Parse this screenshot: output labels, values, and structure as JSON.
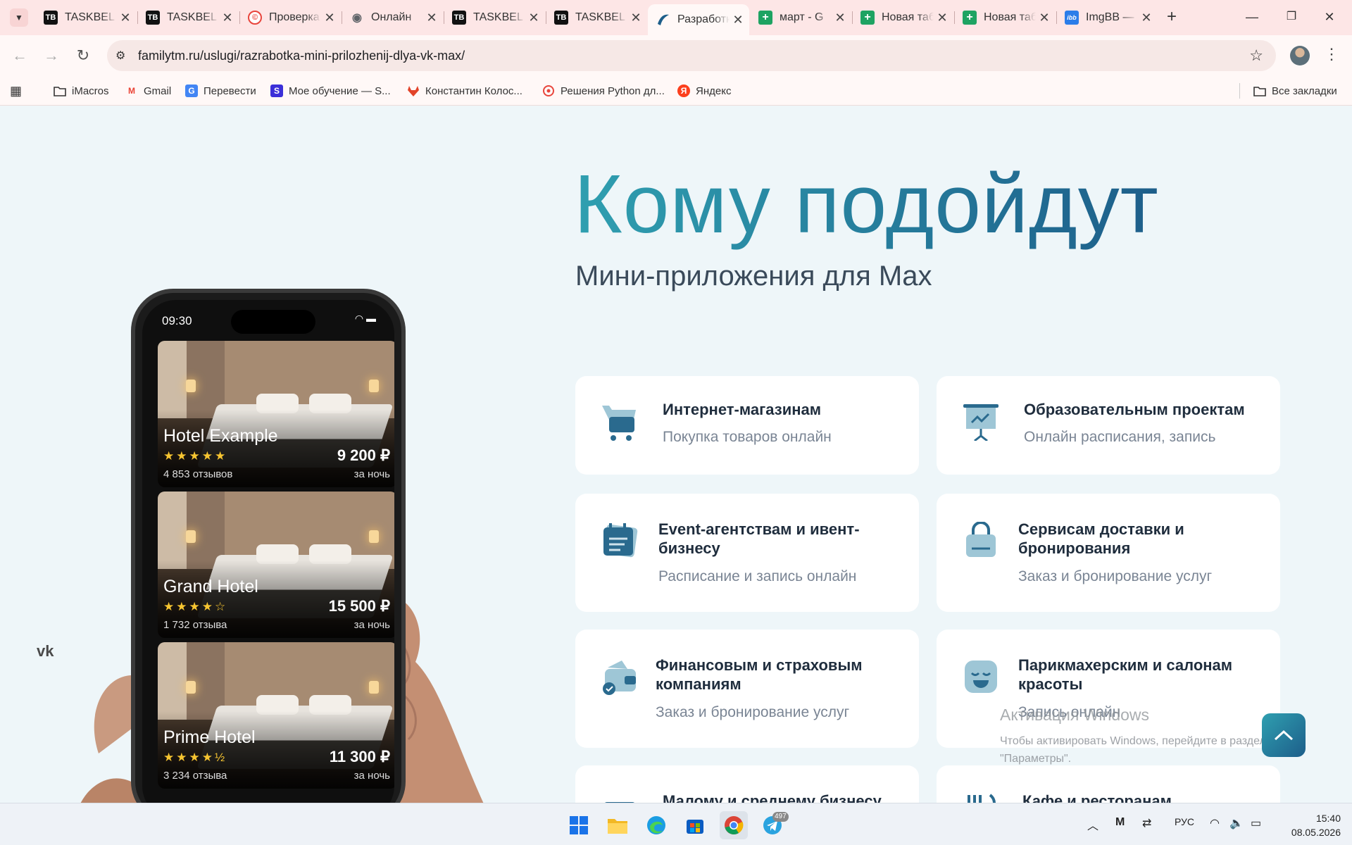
{
  "tabs": [
    {
      "title": "TASKBEL",
      "icon": "taskbel-icon",
      "color": "#111111"
    },
    {
      "title": "TASKBEL",
      "icon": "taskbel-icon",
      "color": "#111111"
    },
    {
      "title": "Проверка",
      "icon": "copyright-icon",
      "color": "#e8453c"
    },
    {
      "title": "Онлайн",
      "icon": "eye-icon",
      "color": "#5f6368"
    },
    {
      "title": "TASKBEL",
      "icon": "taskbel-icon",
      "color": "#111111"
    },
    {
      "title": "TASKBEL",
      "icon": "taskbel-icon",
      "color": "#111111"
    },
    {
      "title": "Разработка",
      "icon": "familytm-icon",
      "color": "#1d5e8a"
    },
    {
      "title": "март - G",
      "icon": "sheets-plus-icon",
      "color": "#1ea362"
    },
    {
      "title": "Новая таблица",
      "icon": "sheets-plus-icon",
      "color": "#1ea362"
    },
    {
      "title": "Новая таблица",
      "icon": "sheets-plus-icon",
      "color": "#1ea362"
    },
    {
      "title": "ImgBB —",
      "icon": "imgbb-icon",
      "color": "#2b7de9"
    }
  ],
  "tab_badges": {
    "tb": "TB",
    "ibb": "ibb",
    "plus": "+"
  },
  "address": {
    "url": "familytm.ru/uslugi/razrabotka-mini-prilozhenij-dlya-vk-max/"
  },
  "bookmarks": [
    {
      "label": "iMacros",
      "icon": "folder-icon"
    },
    {
      "label": "Gmail",
      "icon": "gmail-icon",
      "glyph": "M"
    },
    {
      "label": "Перевести",
      "icon": "translate-icon",
      "glyph": "G"
    },
    {
      "label": "Мое обучение — S...",
      "icon": "skillbox-icon",
      "glyph": "S"
    },
    {
      "label": "Константин Колос...",
      "icon": "gitlab-icon",
      "glyph": ""
    },
    {
      "label": "Решения Python дл...",
      "icon": "python-solutions-icon",
      "glyph": ""
    },
    {
      "label": "Яндекс",
      "icon": "yandex-icon",
      "glyph": "Я"
    }
  ],
  "all_bookmarks": "Все закладки",
  "hero": {
    "title": "Кому подойдут",
    "subtitle": "Мини-приложения для Max"
  },
  "phone": {
    "time": "09:30",
    "hotels": [
      {
        "name": "Hotel Example",
        "stars": "★★★★★",
        "rating": 5,
        "reviews": "4 853 отзывов",
        "price": "9 200 ₽",
        "per": "за ночь"
      },
      {
        "name": "Grand Hotel",
        "stars": "★★★★☆",
        "rating": 4,
        "reviews": "1 732 отзыва",
        "price": "15 500 ₽",
        "per": "за ночь"
      },
      {
        "name": "Prime Hotel",
        "stars": "★★★★½",
        "rating": 4.5,
        "reviews": "3 234 отзыва",
        "price": "11 300 ₽",
        "per": "за ночь"
      }
    ]
  },
  "cards": [
    {
      "title": "Интернет-магазинам",
      "desc": "Покупка товаров онлайн",
      "icon": "cart-icon"
    },
    {
      "title": "Образовательным проектам",
      "desc": "Онлайн расписания, запись",
      "icon": "presentation-board-icon"
    },
    {
      "title": "Event-агентствам и ивент-бизнесу",
      "desc": "Расписание и запись онлайн",
      "icon": "calendar-icon"
    },
    {
      "title": "Сервисам доставки и бронирования",
      "desc": "Заказ и бронирование услуг",
      "icon": "shopping-bag-icon"
    },
    {
      "title": "Финансовым и страховым компаниям",
      "desc": "Заказ и бронирование услуг",
      "icon": "wallet-check-icon"
    },
    {
      "title": "Парикмахерским и салонам красоты",
      "desc": "Запись онлайн",
      "icon": "relaxed-face-icon"
    },
    {
      "title": "Малому и среднему бизнесу",
      "desc": "",
      "icon": "briefcase-icon"
    },
    {
      "title": "Кафе и ресторанам",
      "desc": "",
      "icon": "cutlery-icon"
    }
  ],
  "watermark": {
    "title": "Активация Windows",
    "text": "Чтобы активировать Windows, перейдите в раздел \"Параметры\"."
  },
  "taskbar": {
    "apps": [
      "start-icon",
      "file-explorer-icon",
      "edge-icon",
      "store-icon",
      "chrome-icon",
      "telegram-icon"
    ],
    "telegram_badge": "497",
    "language": "РУС",
    "time": "15:40",
    "date": "08.05.2026"
  },
  "colors": {
    "accent_start": "#2f9fb0",
    "accent_end": "#1d5e8a",
    "page_bg": "#eef6f9",
    "tab_strip": "#fde6e6"
  }
}
